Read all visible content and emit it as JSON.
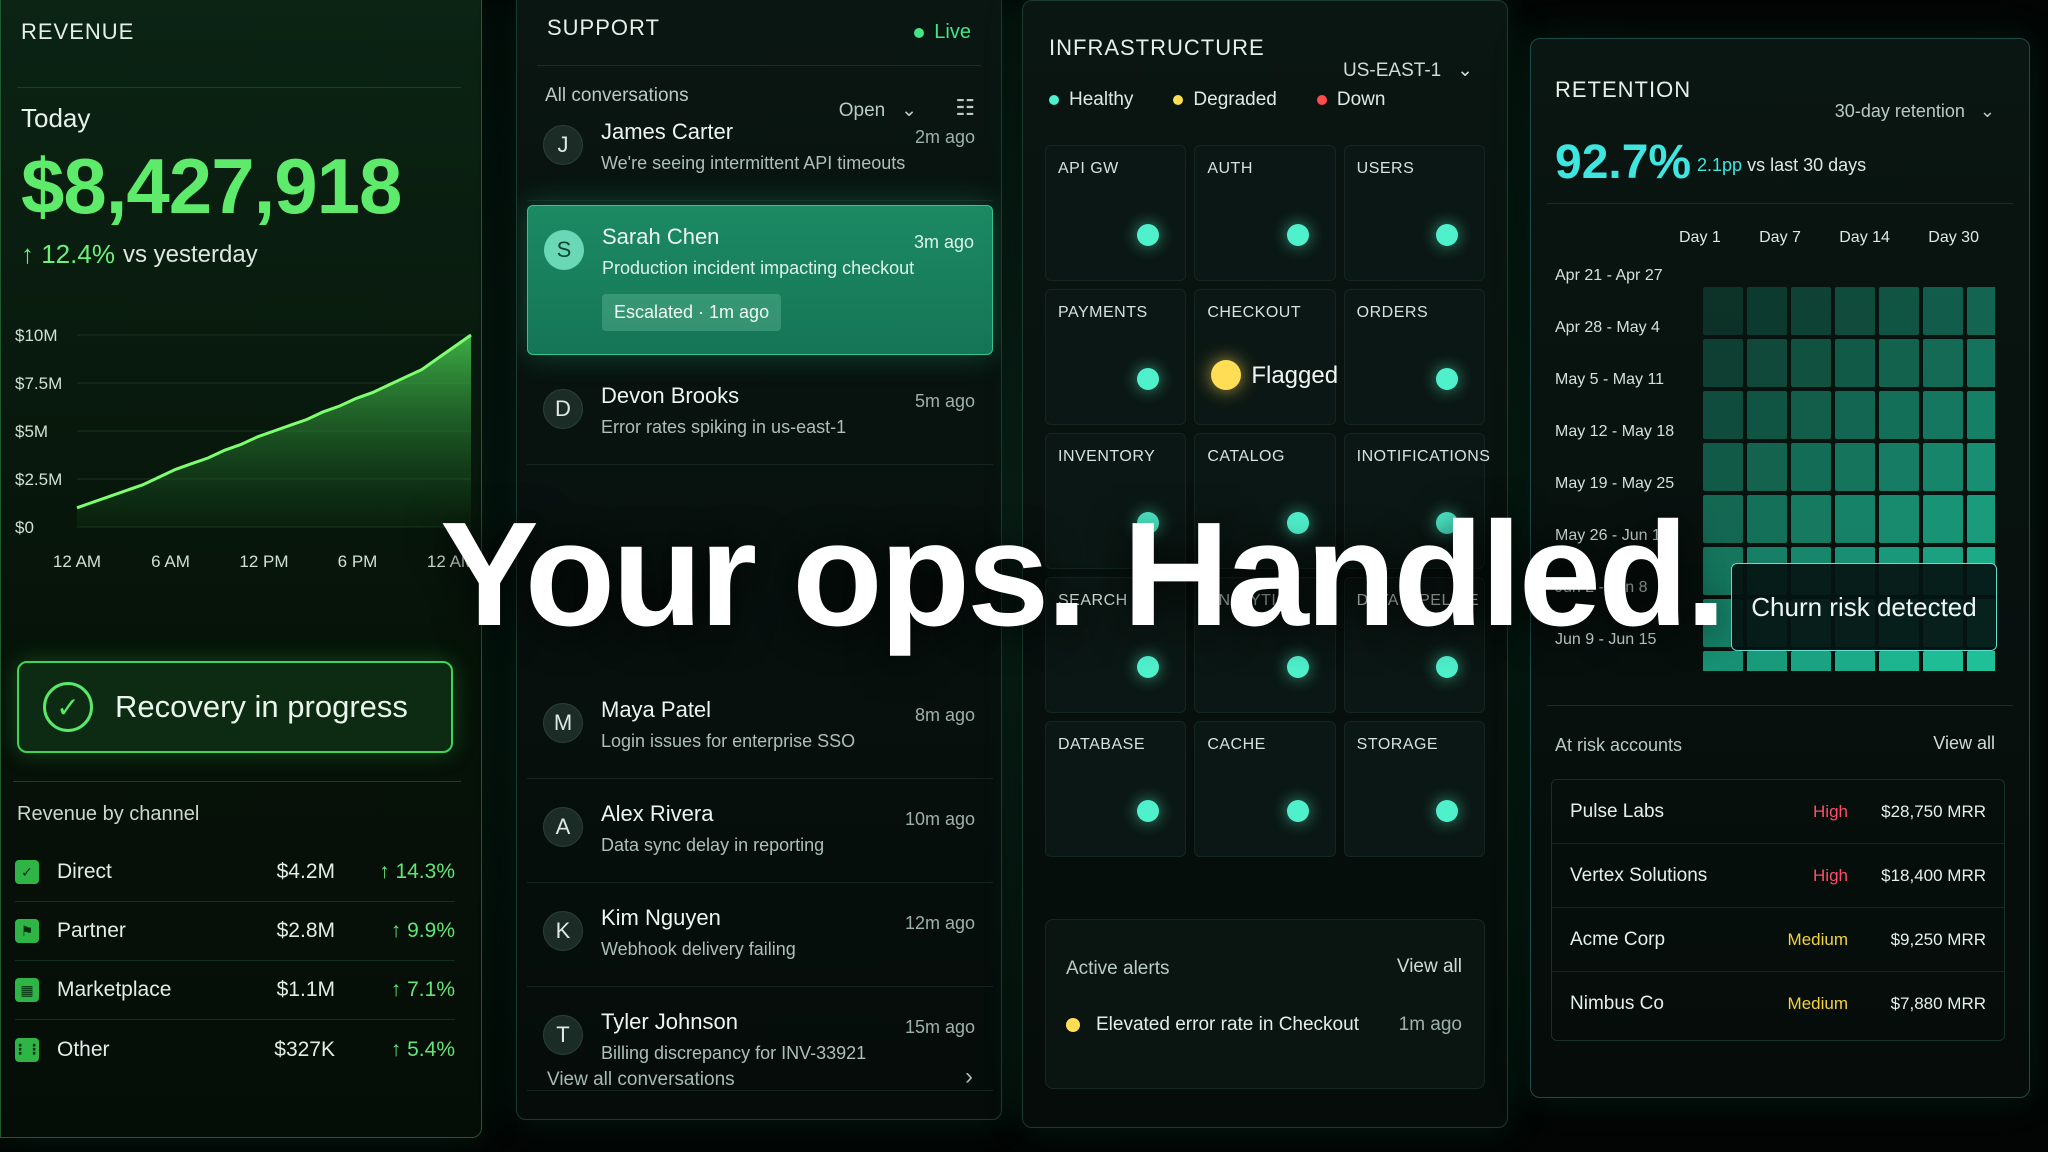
{
  "headline": "Your ops. Handled.",
  "colors": {
    "revenue_green": "#5eea6a",
    "support_teal": "#1c8a64",
    "healthy": "#4ff0cc",
    "degraded": "#ffdd55",
    "down": "#ff4d4d",
    "retention_cyan": "#3fe6e0"
  },
  "revenue": {
    "title": "REVENUE",
    "today_label": "Today",
    "amount": "$8,427,918",
    "delta_pct": "↑ 12.4%",
    "delta_suffix": "vs yesterday",
    "chart_data": {
      "type": "area",
      "x": [
        "12 AM",
        "6 AM",
        "12 PM",
        "6 PM",
        "12 AM"
      ],
      "y_ticks": [
        "$10M",
        "$7.5M",
        "$5M",
        "$2.5M",
        "$0"
      ],
      "ylim": [
        0,
        10
      ],
      "values": [
        1.0,
        1.3,
        1.6,
        1.9,
        2.2,
        2.6,
        3.0,
        3.3,
        3.6,
        4.0,
        4.3,
        4.7,
        5.0,
        5.3,
        5.6,
        6.0,
        6.3,
        6.7,
        7.0,
        7.4,
        7.8,
        8.2,
        8.8,
        9.4,
        10.0
      ]
    },
    "recovery_label": "Recovery in progress",
    "channels_title": "Revenue by channel",
    "channels": [
      {
        "icon": "check-square-icon",
        "glyph": "✓",
        "name": "Direct",
        "value": "$4.2M",
        "pct": "↑ 14.3%"
      },
      {
        "icon": "partner-icon",
        "glyph": "⚑",
        "name": "Partner",
        "value": "$2.8M",
        "pct": "↑ 9.9%"
      },
      {
        "icon": "marketplace-icon",
        "glyph": "▦",
        "name": "Marketplace",
        "value": "$1.1M",
        "pct": "↑ 7.1%"
      },
      {
        "icon": "other-icon",
        "glyph": "⋮⋮",
        "name": "Other",
        "value": "$327K",
        "pct": "↑ 5.4%"
      }
    ]
  },
  "support": {
    "title": "SUPPORT",
    "live": "Live",
    "filter": "All conversations",
    "status_filter": "Open",
    "conversations": [
      {
        "initial": "J",
        "name": "James Carter",
        "message": "We're seeing intermittent API timeouts",
        "time": "2m ago"
      },
      {
        "initial": "S",
        "name": "Sarah Chen",
        "message": "Production incident impacting checkout",
        "time": "3m ago",
        "badge": "Escalated · 1m ago"
      },
      {
        "initial": "D",
        "name": "Devon Brooks",
        "message": "Error rates spiking in us-east-1",
        "time": "5m ago"
      },
      {
        "initial": "M",
        "name": "Maya Patel",
        "message": "Login issues for enterprise SSO",
        "time": "8m ago"
      },
      {
        "initial": "A",
        "name": "Alex Rivera",
        "message": "Data sync delay in reporting",
        "time": "10m ago"
      },
      {
        "initial": "K",
        "name": "Kim Nguyen",
        "message": "Webhook delivery failing",
        "time": "12m ago"
      },
      {
        "initial": "T",
        "name": "Tyler Johnson",
        "message": "Billing discrepancy for INV-33921",
        "time": "15m ago"
      }
    ],
    "view_all": "View all conversations"
  },
  "infra": {
    "title": "INFRASTRUCTURE",
    "region": "US-EAST-1",
    "legend": {
      "healthy": "Healthy",
      "degraded": "Degraded",
      "down": "Down"
    },
    "services": [
      {
        "name": "API GW",
        "status": "healthy"
      },
      {
        "name": "AUTH",
        "status": "healthy"
      },
      {
        "name": "USERS",
        "status": "healthy"
      },
      {
        "name": "PAYMENTS",
        "status": "healthy"
      },
      {
        "name": "CHECKOUT",
        "status": "degraded",
        "flag": "Flagged"
      },
      {
        "name": "ORDERS",
        "status": "healthy"
      },
      {
        "name": "INVENTORY",
        "status": "healthy"
      },
      {
        "name": "CATALOG",
        "status": "healthy"
      },
      {
        "name": "INOTIFICATIONS",
        "status": "healthy"
      },
      {
        "name": "SEARCH",
        "status": "healthy"
      },
      {
        "name": "ANALYTICS",
        "status": "healthy"
      },
      {
        "name": "DATA PIPELINE",
        "status": "healthy"
      },
      {
        "name": "DATABASE",
        "status": "healthy"
      },
      {
        "name": "CACHE",
        "status": "healthy"
      },
      {
        "name": "STORAGE",
        "status": "healthy"
      }
    ],
    "alerts_title": "Active alerts",
    "alerts_view_all": "View all",
    "alert": {
      "text": "Elevated error rate in Checkout",
      "time": "1m ago"
    }
  },
  "retention": {
    "title": "RETENTION",
    "selector": "30-day retention",
    "value": "92.7%",
    "delta": "↑ 2.1pp",
    "delta_suffix": "vs last 30 days",
    "day_labels": [
      "Day 1",
      "Day 7",
      "Day 14",
      "Day 30"
    ],
    "cohorts": [
      "Apr 21 - Apr 27",
      "Apr 28 - May 4",
      "May 5 - May 11",
      "May 12 - May 18",
      "May 19 - May 25",
      "May 26 - Jun 1",
      "Jun 2 - Jun 8",
      "Jun 9 - Jun 15"
    ],
    "churn_label": "Churn risk detected",
    "at_risk_title": "At risk accounts",
    "at_risk_view_all": "View all",
    "accounts": [
      {
        "name": "Pulse Labs",
        "risk": "High",
        "risk_color": "#ff4d6a",
        "mrr": "$28,750 MRR"
      },
      {
        "name": "Vertex Solutions",
        "risk": "High",
        "risk_color": "#ff4d6a",
        "mrr": "$18,400 MRR"
      },
      {
        "name": "Acme Corp",
        "risk": "Medium",
        "risk_color": "#f2d33a",
        "mrr": "$9,250 MRR"
      },
      {
        "name": "Nimbus Co",
        "risk": "Medium",
        "risk_color": "#f2d33a",
        "mrr": "$7,880 MRR"
      }
    ]
  }
}
